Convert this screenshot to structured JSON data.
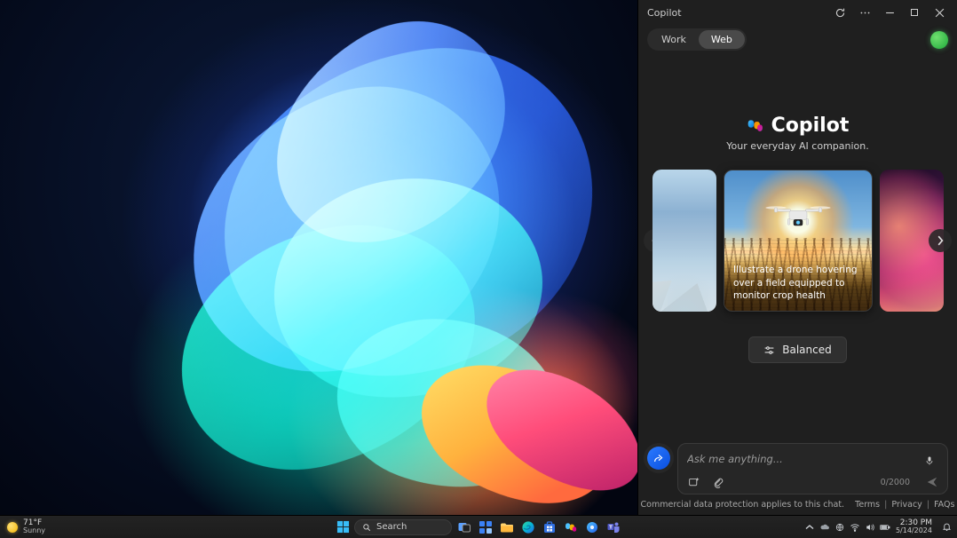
{
  "copilot": {
    "window_title": "Copilot",
    "tabs": {
      "work": "Work",
      "web": "Web",
      "active": "web"
    },
    "hero": {
      "title": "Copilot",
      "subtitle": "Your everyday AI companion."
    },
    "carousel": {
      "center_caption": "Illustrate a drone hovering over a field equipped to monitor crop health"
    },
    "style_button": "Balanced",
    "compose": {
      "placeholder": "Ask me anything...",
      "counter": "0/2000"
    },
    "footer": {
      "protection": "Commercial data protection",
      "applies": " applies to this chat.",
      "terms": "Terms",
      "privacy": "Privacy",
      "faqs": "FAQs"
    }
  },
  "taskbar": {
    "weather": {
      "temp": "71°F",
      "desc": "Sunny"
    },
    "search_placeholder": "Search",
    "clock": {
      "time": "2:30 PM",
      "date": "5/14/2024"
    }
  }
}
